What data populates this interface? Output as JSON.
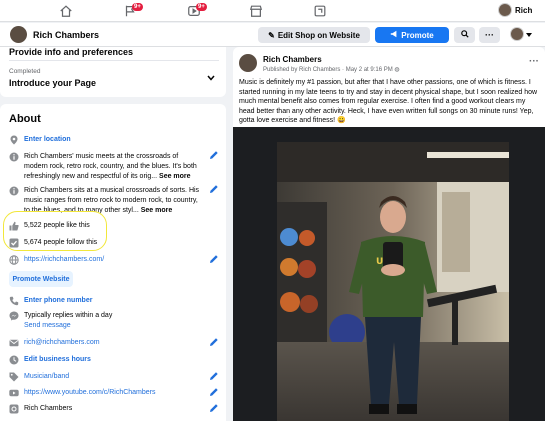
{
  "nav": {
    "notification_badge": "9+",
    "video_badge": "9+",
    "user_name": "Rich"
  },
  "page": {
    "name": "Rich Chambers",
    "edit_shop_label": "Edit Shop on Website",
    "promote_label": "Promote"
  },
  "setup": {
    "cut_text": "Provide info and preferences",
    "status": "Completed",
    "title": "Introduce your Page"
  },
  "about": {
    "heading": "About",
    "enter_location": "Enter location",
    "bio1": "Rich Chambers' music meets at the crossroads of modern rock, retro rock, country, and the blues. It's both refreshingly new and respectful of its orig...",
    "bio2": "Rich Chambers sits at a musical crossroads of sorts. His music ranges from retro rock to modern rock, to country, to the blues, and to many other styl...",
    "see_more": "See more",
    "likes": "5,522 people like this",
    "follows": "5,674 people follow this",
    "website": "https://richchambers.com/",
    "promote_website": "Promote Website",
    "enter_phone": "Enter phone number",
    "reply_time": "Typically replies within a day",
    "send_message": "Send message",
    "email": "rich@richchambers.com",
    "edit_hours": "Edit business hours",
    "category": "Musician/band",
    "youtube": "https://www.youtube.com/c/RichChambers",
    "last_item": "Rich Chambers"
  },
  "post": {
    "author": "Rich Chambers",
    "published_by": "Published by Rich Chambers",
    "date": "May 2 at 9:16 PM",
    "text": "Music is definitely my #1 passion, but after that I have other passions, one of which is fitness. I started running in my late teens to try and stay in decent physical shape, but I soon realized how much mental benefit also comes from regular exercise. I often find a good workout clears my head better than any other activity. Heck, I have even written full songs on 30 minute runs! Yep, gotta love exercise and fitness! 😀"
  },
  "colors": {
    "accent": "#1877f2",
    "link": "#216fdb",
    "highlight": "#f2e73a"
  }
}
